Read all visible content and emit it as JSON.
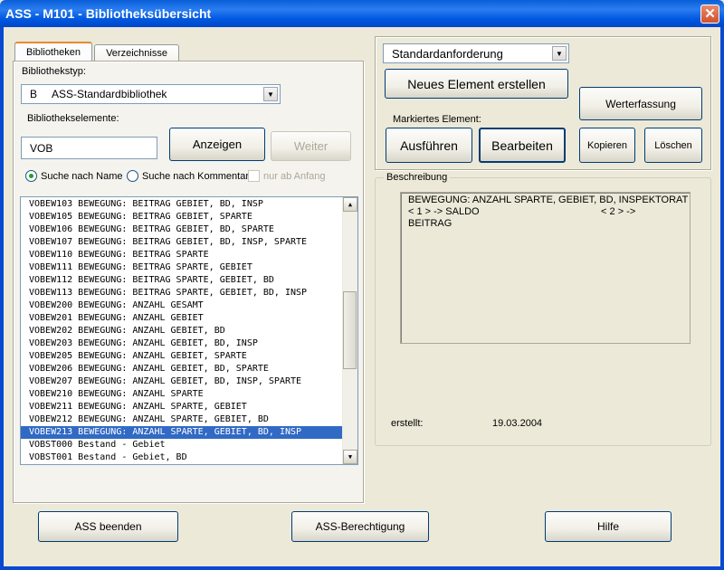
{
  "window": {
    "title": "ASS - M101 - Bibliotheksübersicht",
    "close_label": "✕"
  },
  "tabs": [
    {
      "label": "Bibliotheken",
      "active": true
    },
    {
      "label": "Verzeichnisse",
      "active": false
    }
  ],
  "library": {
    "type_label": "Bibliothekstyp:",
    "type_code": "B",
    "type_value": "ASS-Standardbibliothek",
    "elements_label": "Bibliothekselemente:",
    "search_value": "VOB",
    "show_button": "Anzeigen",
    "next_button": "Weiter",
    "radio_name": "Suche nach Name",
    "radio_comment": "Suche nach Kommentar",
    "check_start": "nur ab Anfang"
  },
  "list_items": [
    "VOBEW103  BEWEGUNG: BEITRAG GEBIET, BD, INSP",
    "VOBEW105  BEWEGUNG: BEITRAG GEBIET, SPARTE",
    "VOBEW106  BEWEGUNG: BEITRAG GEBIET, BD, SPARTE",
    "VOBEW107  BEWEGUNG: BEITRAG GEBIET, BD, INSP, SPARTE",
    "VOBEW110  BEWEGUNG: BEITRAG SPARTE",
    "VOBEW111  BEWEGUNG: BEITRAG SPARTE, GEBIET",
    "VOBEW112  BEWEGUNG: BEITRAG SPARTE, GEBIET, BD",
    "VOBEW113  BEWEGUNG: BEITRAG SPARTE, GEBIET, BD, INSP",
    "VOBEW200  BEWEGUNG: ANZAHL GESAMT",
    "VOBEW201  BEWEGUNG: ANZAHL GEBIET",
    "VOBEW202  BEWEGUNG: ANZAHL GEBIET, BD",
    "VOBEW203  BEWEGUNG: ANZAHL GEBIET, BD, INSP",
    "VOBEW205  BEWEGUNG: ANZAHL GEBIET, SPARTE",
    "VOBEW206  BEWEGUNG: ANZAHL GEBIET, BD, SPARTE",
    "VOBEW207  BEWEGUNG: ANZAHL GEBIET, BD, INSP, SPARTE",
    "VOBEW210  BEWEGUNG: ANZAHL SPARTE",
    "VOBEW211  BEWEGUNG: ANZAHL SPARTE, GEBIET",
    "VOBEW212  BEWEGUNG: ANZAHL SPARTE, GEBIET, BD",
    "VOBEW213  BEWEGUNG: ANZAHL SPARTE, GEBIET, BD, INSP",
    "VOBST000  Bestand - Gebiet",
    "VOBST001  Bestand - Gebiet, BD"
  ],
  "selected_index": 18,
  "actions": {
    "request_value": "Standardanforderung",
    "new_element": "Neues Element erstellen",
    "value_entry": "Werterfassung",
    "marked_label": "Markiertes Element:",
    "execute": "Ausführen",
    "edit": "Bearbeiten",
    "copy": "Kopieren",
    "delete": "Löschen"
  },
  "description": {
    "legend": "Beschreibung",
    "text": "BEWEGUNG: ANZAHL SPARTE, GEBIET, BD, INSPEKTORAT\n< 1 > -> SALDO                                            < 2 > ->\nBEITRAG",
    "created_label": "erstellt:",
    "created_value": "19.03.2004"
  },
  "footer": {
    "quit": "ASS beenden",
    "permission": "ASS-Berechtigung",
    "help": "Hilfe"
  }
}
